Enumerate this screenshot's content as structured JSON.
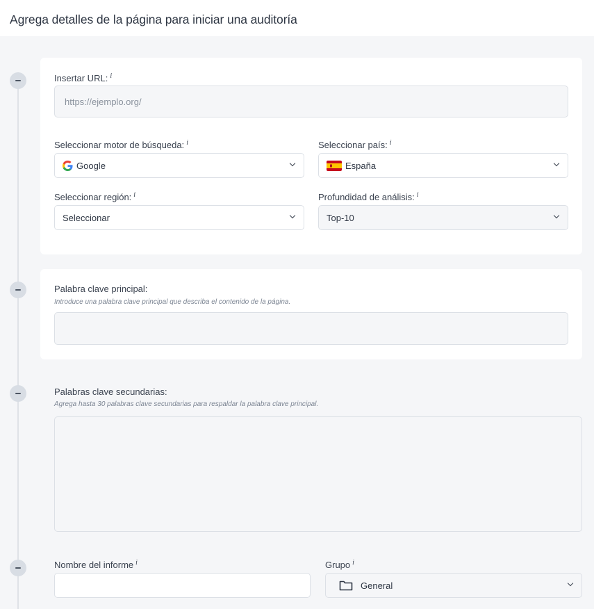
{
  "header": {
    "title": "Agrega detalles de la página para iniciar una auditoría"
  },
  "url_section": {
    "label": "Insertar URL:",
    "info": "i",
    "placeholder": "https://ejemplo.org/"
  },
  "engine": {
    "label": "Seleccionar motor de búsqueda:",
    "info": "i",
    "value": "Google",
    "icon": "google-icon"
  },
  "country": {
    "label": "Seleccionar país:",
    "info": "i",
    "value": "España",
    "icon": "spain-flag-icon"
  },
  "region": {
    "label": "Seleccionar región:",
    "info": "i",
    "value": "Seleccionar"
  },
  "depth": {
    "label": "Profundidad de análisis:",
    "info": "i",
    "value": "Top-10"
  },
  "main_keyword": {
    "label": "Palabra clave principal:",
    "hint": "Introduce una palabra clave principal que describa el contenido de la página.",
    "value": ""
  },
  "secondary_keywords": {
    "label": "Palabras clave secundarias:",
    "hint": "Agrega hasta 30 palabras clave secundarias para respaldar la palabra clave principal.",
    "value": ""
  },
  "report_name": {
    "label": "Nombre del informe",
    "info": "i",
    "value": ""
  },
  "group": {
    "label": "Grupo",
    "info": "i",
    "value": "General",
    "icon": "folder-icon"
  },
  "colors": {
    "page_bg": "#f5f6f8",
    "card_bg": "#ffffff",
    "toggle_bg": "#d8dde4",
    "google_blue": "#4285f4",
    "spain_red": "#c60b1e",
    "spain_yellow": "#ffc400"
  }
}
